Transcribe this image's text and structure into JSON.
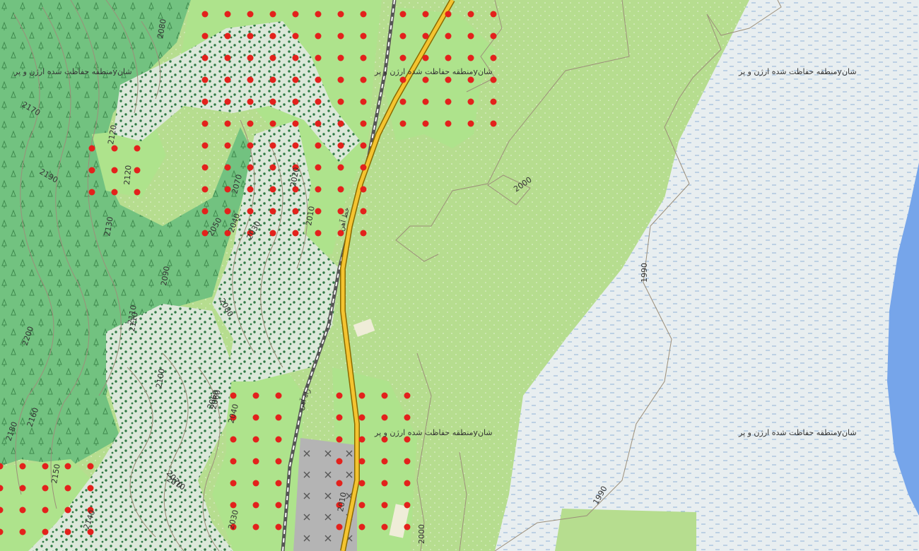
{
  "map": {
    "colors": {
      "meadow": "#b6dd8f",
      "forest": "#6fbf7c",
      "forest_dark": "#5fae6d",
      "orchard": "#aee38c",
      "scrub": "#dfe8dc",
      "wetland": "#e8eef0",
      "water": "#76a5ea",
      "quarry": "#b0b0b0",
      "road": "#f4c430",
      "rail": "#555555",
      "contour": "#9c8f7a"
    },
    "protected_area_labels": [
      "شان‌yمنطقه حفاظت شده ارژن و پر",
      "شان‌yمنطقه حفاظت شده ارژن و پر",
      "شان‌yمنطقه حفاظت شده ارژن و پر",
      "شان‌yمنطقه حفاظت شده ارژن و پر",
      "شان‌yمنطقه حفاظت شده ارژن و پر"
    ],
    "rail_label_1": "خط آهن",
    "rail_label_2": "راه آهن",
    "contour_labels": [
      "2080",
      "2170",
      "2190",
      "2120",
      "2070",
      "2020",
      "2010",
      "2040",
      "2050",
      "2030",
      "2090",
      "2080",
      "2070",
      "2060",
      "2100",
      "2110",
      "2180",
      "2160",
      "2140",
      "2150",
      "2120",
      "2110",
      "2070",
      "2060",
      "2040",
      "2030",
      "2010",
      "2000",
      "1990",
      "1990",
      "2000",
      "2200",
      "2130"
    ]
  }
}
